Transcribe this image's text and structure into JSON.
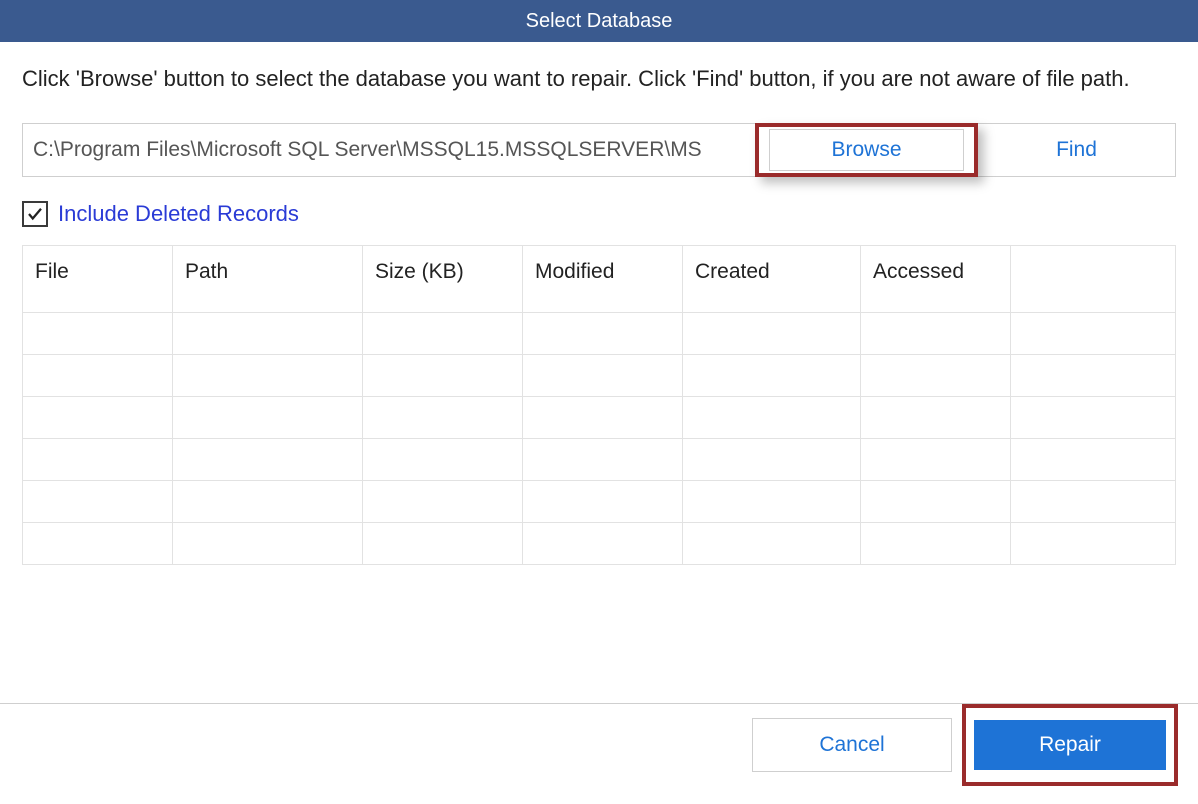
{
  "titlebar": {
    "title": "Select Database"
  },
  "instruction": "Click 'Browse' button to select the database you want to repair. Click 'Find' button, if you are not aware of file path.",
  "path_input": {
    "value": "C:\\Program Files\\Microsoft SQL Server\\MSSQL15.MSSQLSERVER\\MS"
  },
  "buttons": {
    "browse": "Browse",
    "find": "Find",
    "cancel": "Cancel",
    "repair": "Repair"
  },
  "checkbox": {
    "checked": true,
    "label": "Include Deleted Records"
  },
  "table": {
    "columns": [
      "File",
      "Path",
      "Size (KB)",
      "Modified",
      "Created",
      "Accessed",
      ""
    ],
    "rows": [
      [
        "",
        "",
        "",
        "",
        "",
        "",
        ""
      ],
      [
        "",
        "",
        "",
        "",
        "",
        "",
        ""
      ],
      [
        "",
        "",
        "",
        "",
        "",
        "",
        ""
      ],
      [
        "",
        "",
        "",
        "",
        "",
        "",
        ""
      ],
      [
        "",
        "",
        "",
        "",
        "",
        "",
        ""
      ],
      [
        "",
        "",
        "",
        "",
        "",
        "",
        ""
      ]
    ]
  }
}
